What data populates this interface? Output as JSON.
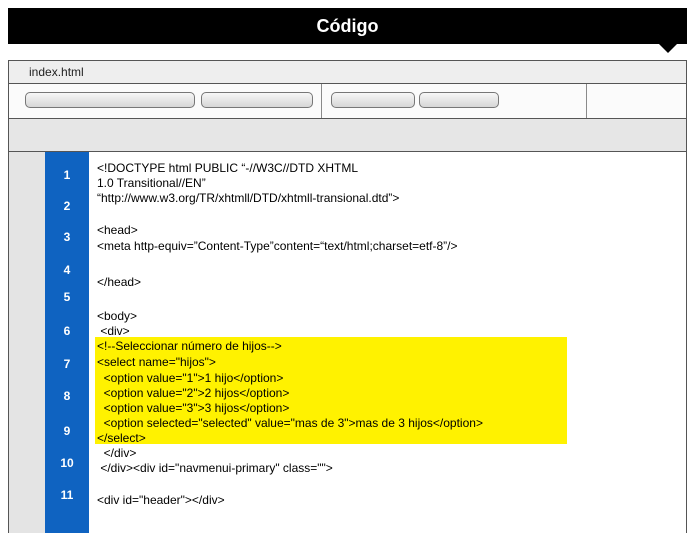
{
  "window": {
    "title": "Código"
  },
  "file_tab": {
    "name": "index.html"
  },
  "gutter": {
    "line_numbers": [
      "1",
      "2",
      "3",
      "4",
      "5",
      "6",
      "7",
      "8",
      "9",
      "10",
      "11"
    ]
  },
  "code": {
    "lines": [
      "<!DOCTYPE html PUBLIC “-//W3C//DTD XHTML",
      "1.0 Transitional//EN”",
      "“http://www.w3.org/TR/xhtmll/DTD/xhtmll-transional.dtd”>",
      "<head>",
      "<meta http-equiv=”Content-Type”content=“text/html;charset=etf-8”/>",
      "</head>",
      "<body>",
      " <div>",
      "<!--Seleccionar número de hijos-->",
      "<select name=\"hijos\">",
      "  <option value=\"1\">1 hijo</option>",
      "  <option value=\"2\">2 hijos</option>",
      "  <option value=\"3\">3 hijos</option>",
      "  <option selected=\"selected\" value=\"mas de 3\">mas de 3 hijos</option>",
      "</select>",
      "  </div>",
      " </div><div id=\"navmenui-primary\" class=\"\">",
      "<div id=\"header\"></div>"
    ]
  },
  "highlight": {
    "color": "#fff200"
  },
  "colors": {
    "gutter": "#0f63c1",
    "titlebar": "#000000"
  }
}
